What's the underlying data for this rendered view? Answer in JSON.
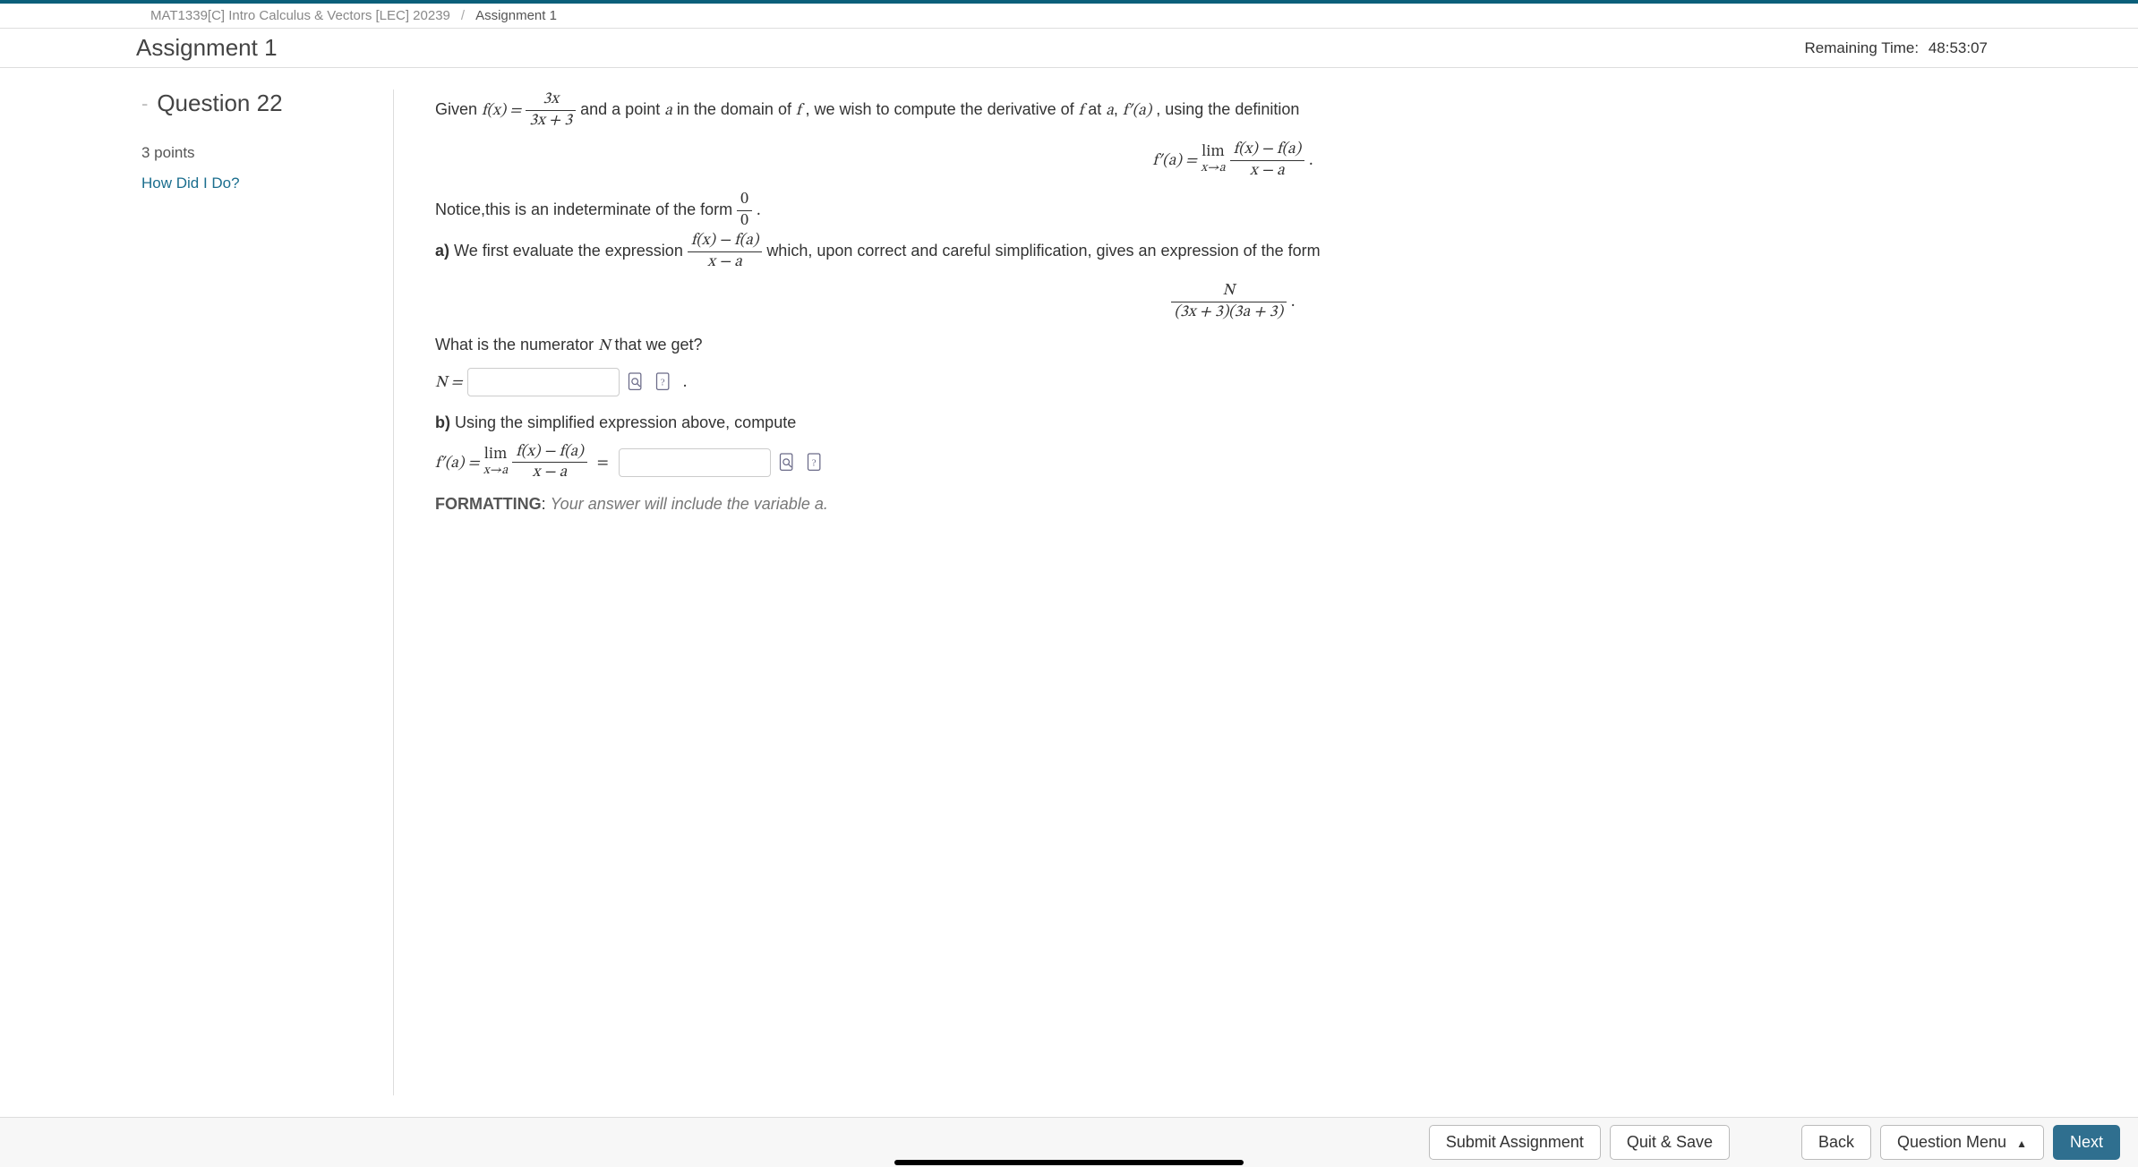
{
  "breadcrumb": {
    "course": "MAT1339[C] Intro Calculus & Vectors [LEC] 20239",
    "current": "Assignment 1"
  },
  "header": {
    "title": "Assignment 1",
    "remaining_label": "Remaining Time:",
    "remaining_value": "48:53:07"
  },
  "sidebar": {
    "question_label": "Question 22",
    "points": "3 points",
    "how_did_i_do": "How Did I Do?"
  },
  "question": {
    "intro_pre": "Given ",
    "fx_lhs": "f(x) =",
    "fx_num": "3x",
    "fx_den": "3x + 3",
    "intro_mid": " and a point ",
    "a_var": "a",
    "intro_mid2": " in the domain of ",
    "f_var": "f",
    "intro_mid3": ", we wish to compute the derivative of ",
    "intro_mid4": " at ",
    "fpa": "f′(a)",
    "intro_end": ", using the definition",
    "limit_lhs": "f′(a) = ",
    "lim_label": "lim",
    "lim_sub": "x→a",
    "diffq_num": "f(x) − f(a)",
    "diffq_den": "x − a",
    "period": ".",
    "indet_pre": "Notice,this is an indeterminate of the form ",
    "zero_num": "0",
    "zero_den": "0",
    "a_label": "a)",
    "a_text1": " We first evaluate the expression ",
    "a_text2": " which, upon correct and careful simplification, gives an expression of the form",
    "N_var": "N",
    "simp_den": "(3x + 3)(3a + 3)",
    "a_question": "What is the numerator ",
    "a_question2": " that we get?",
    "n_equals": "N =",
    "b_label": "b)",
    "b_text": " Using the simplified expression above, compute",
    "equals": "=",
    "formatting_label": "FORMATTING",
    "formatting_colon": ": ",
    "formatting_text": "Your answer will include the variable a."
  },
  "footer": {
    "submit": "Submit Assignment",
    "quit": "Quit & Save",
    "back": "Back",
    "menu": "Question Menu",
    "next": "Next"
  },
  "icons": {
    "preview": "preview-icon",
    "help": "help-icon"
  }
}
